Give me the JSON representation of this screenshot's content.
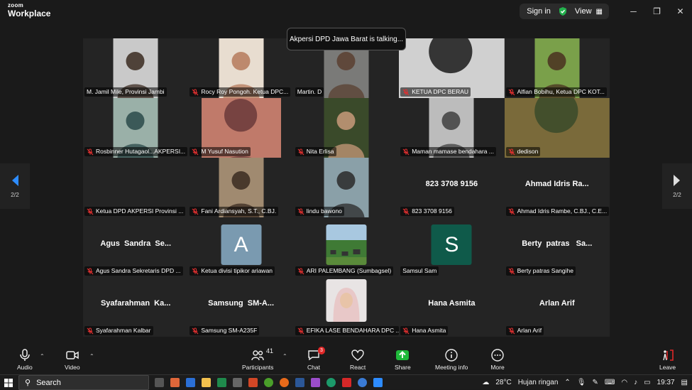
{
  "app": {
    "logo_line1": "zoom",
    "logo_line2": "Workplace"
  },
  "topbar": {
    "sign_in": "Sign in",
    "view": "View"
  },
  "talking_indicator": "Akpersi DPD Jawa Barat is talking...",
  "pagination": {
    "left": "2/2",
    "right": "2/2"
  },
  "rows": [
    [
      {
        "label": "M. Jamil Mile, Provinsi Jambi",
        "muted": false,
        "type": "video",
        "bg": "#c9c9c9",
        "fg": "#3a2a20"
      },
      {
        "label": "Rocy Roy Pongoh. Ketua DPC...",
        "muted": true,
        "type": "video",
        "bg": "#e8ddd0",
        "fg": "#b57a5c"
      },
      {
        "label": "Martin. D",
        "muted": false,
        "type": "video",
        "bg": "#7a7a78",
        "fg": "#5a4030"
      },
      {
        "label": "KETUA DPC BERAU",
        "muted": true,
        "type": "video-wide",
        "bg": "#d0d0d0",
        "fg": "#1a1a1a"
      },
      {
        "label": "Alfian Bobihu, Ketua DPC KOT...",
        "muted": true,
        "type": "video",
        "bg": "#7aa04a",
        "fg": "#4a3020"
      }
    ],
    [
      {
        "label": "Rosbinner Hutagaol...AKPERSI...",
        "muted": true,
        "type": "video",
        "bg": "#9ab0a8",
        "fg": "#2a4a4a"
      },
      {
        "label": "M Yusuf Nasution",
        "muted": true,
        "type": "video-mid",
        "bg": "#c07a6a",
        "fg": "#6a3a3a"
      },
      {
        "label": "Nita Erlisa",
        "muted": true,
        "type": "video",
        "bg": "#3a4a2a",
        "fg": "#c89a7a"
      },
      {
        "label": "Maman mamase bendahara ...",
        "muted": true,
        "type": "video",
        "bg": "#bcbcbc",
        "fg": "#404040"
      },
      {
        "label": "dedison",
        "muted": true,
        "type": "video-wide",
        "bg": "#7a6a3a",
        "fg": "#3a4a2a"
      }
    ],
    [
      {
        "label": "Ketua DPD AKPERSI Provinsi ...",
        "muted": true,
        "type": "blank"
      },
      {
        "label": "Fani Ardiansyah, S.T., C.BJ.",
        "muted": true,
        "type": "video",
        "bg": "#a08a70",
        "fg": "#3a2a20"
      },
      {
        "label": "lindu bawono",
        "muted": true,
        "type": "video",
        "bg": "#8aa0a8",
        "fg": "#2a2a2a"
      },
      {
        "label": "823 3708 9156",
        "muted": true,
        "type": "name",
        "big": "823 3708 9156"
      },
      {
        "label": "Ahmad Idris Rambe, C.BJ., C.E...",
        "muted": true,
        "type": "name",
        "big": "Ahmad Idris Ra..."
      }
    ],
    [
      {
        "label": "Agus Sandra Sekretaris DPD ...",
        "muted": true,
        "type": "name",
        "big": "Agus  Sandra  Se..."
      },
      {
        "label": "Ketua divisi tipikor ariawan",
        "muted": true,
        "type": "avatar",
        "letter": "A",
        "color": "#7a9ab0"
      },
      {
        "label": "ARI  PALEMBANG (Sumbagsel)",
        "muted": true,
        "type": "photo-landscape"
      },
      {
        "label": "Samsul Sam",
        "muted": false,
        "type": "avatar",
        "letter": "S",
        "color": "#0f5a4a"
      },
      {
        "label": "Berty patras  Sangihe",
        "muted": true,
        "type": "name",
        "big": "Berty  patras   Sa..."
      }
    ],
    [
      {
        "label": "Syafarahman Kalbar",
        "muted": true,
        "type": "name",
        "big": "Syafarahman  Ka..."
      },
      {
        "label": "Samsung SM-A235F",
        "muted": true,
        "type": "name",
        "big": "Samsung  SM-A..."
      },
      {
        "label": "EFIKA LASE BENDAHARA DPC ...",
        "muted": true,
        "type": "photo-portrait"
      },
      {
        "label": "Hana Asmita",
        "muted": true,
        "type": "name",
        "big": "Hana Asmita"
      },
      {
        "label": "Arlan Arif",
        "muted": true,
        "type": "name",
        "big": "Arlan Arif"
      }
    ]
  ],
  "toolbar": {
    "audio": "Audio",
    "video": "Video",
    "participants": "Participants",
    "participants_count": "41",
    "chat": "Chat",
    "chat_badge": "3",
    "react": "React",
    "share": "Share",
    "meeting_info": "Meeting info",
    "more": "More",
    "leave": "Leave",
    "share_color": "#1fba3a",
    "leave_color": "#e02828"
  },
  "taskbar": {
    "search": "Search",
    "weather": "28°C",
    "weather_text": "Hujan ringan",
    "time": "19:37"
  }
}
